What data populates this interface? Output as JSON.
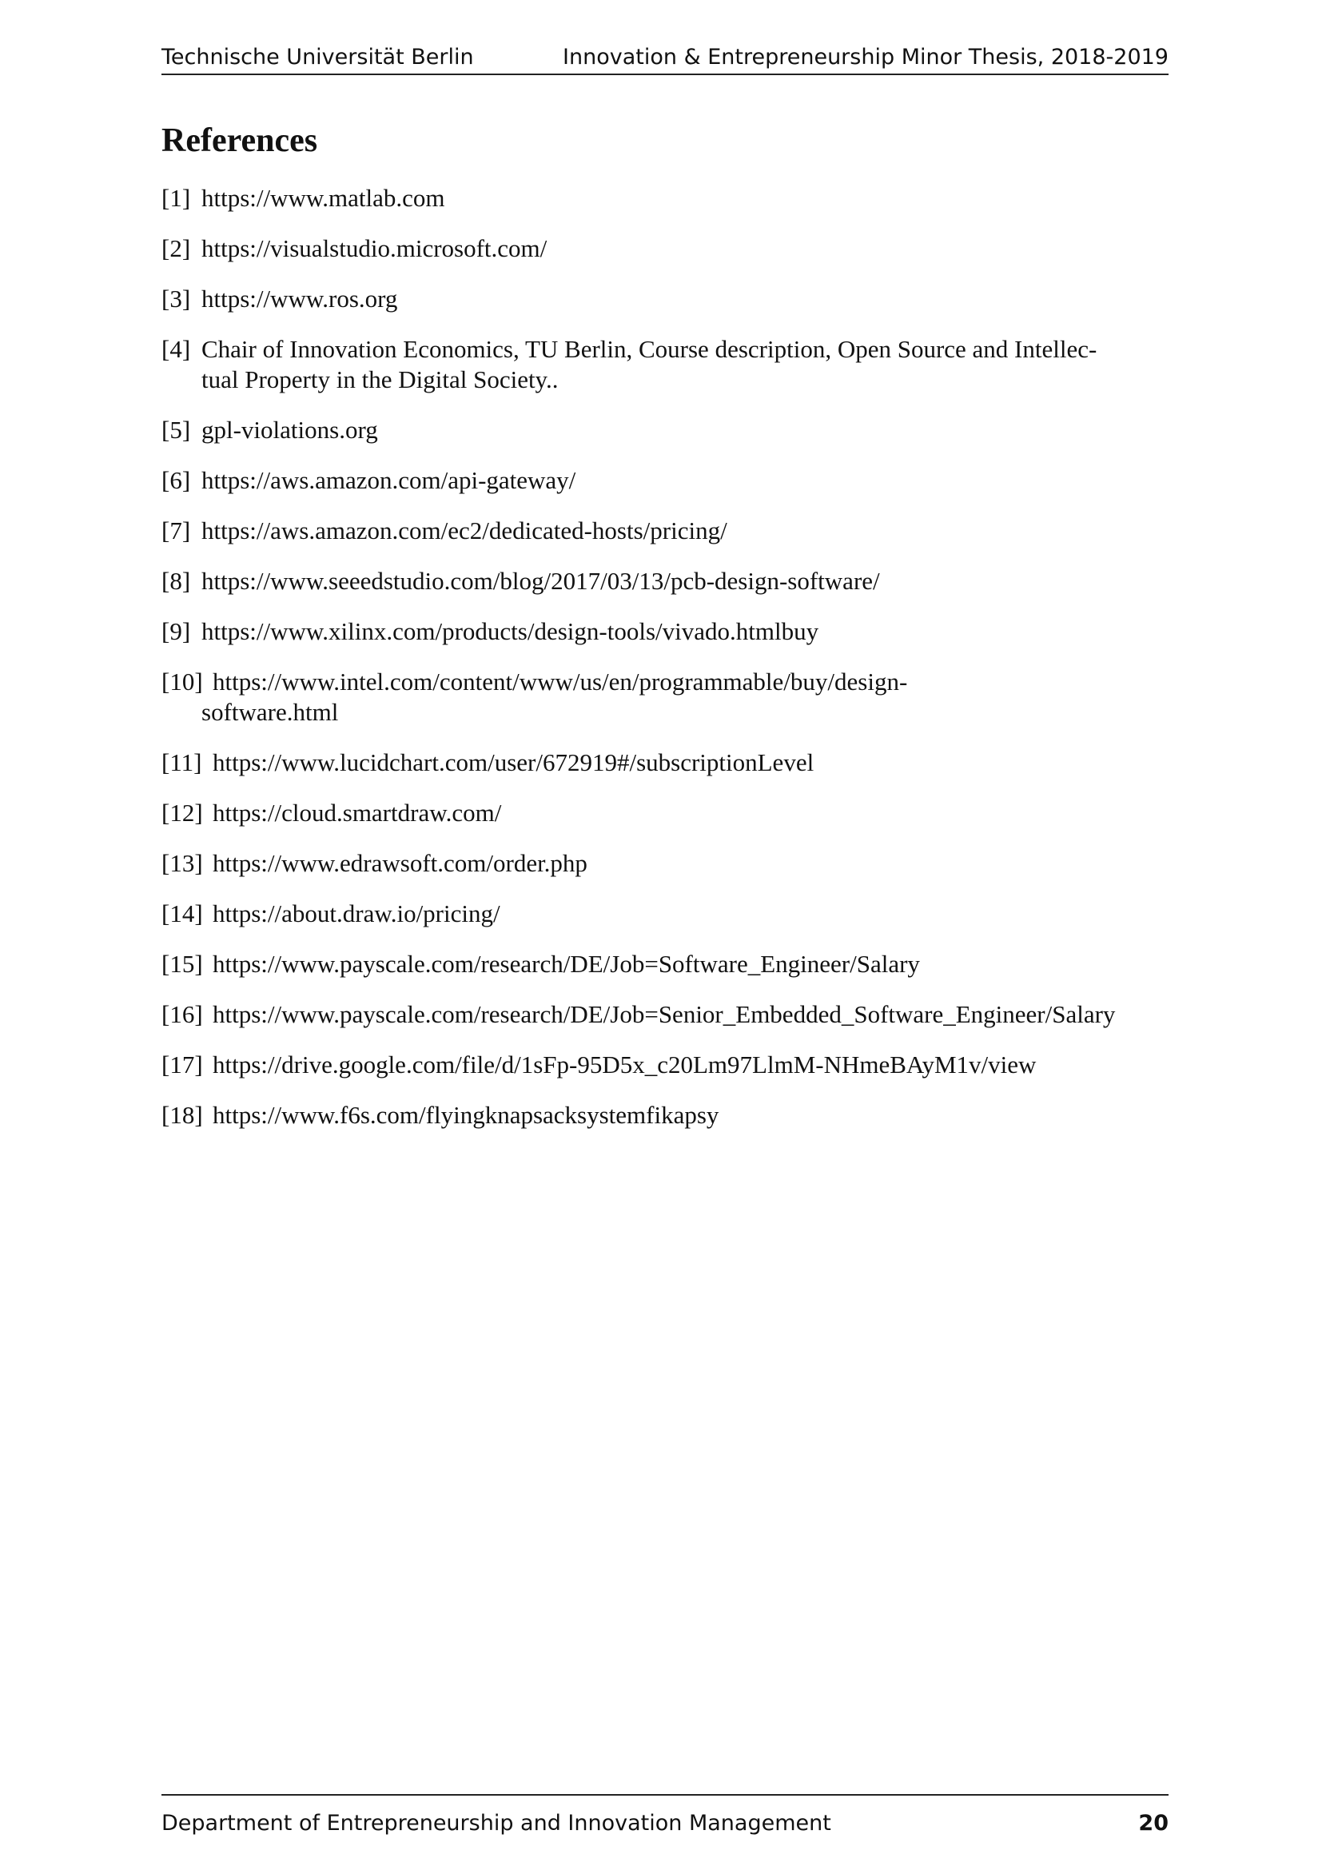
{
  "header": {
    "left": "Technische Universität Berlin",
    "right": "Innovation & Entrepreneurship Minor Thesis, 2018-2019"
  },
  "section_title": "References",
  "references": [
    {
      "num": "[1]",
      "text": "https://www.matlab.com"
    },
    {
      "num": "[2]",
      "text": "https://visualstudio.microsoft.com/"
    },
    {
      "num": "[3]",
      "text": "https://www.ros.org"
    },
    {
      "num": "[4]",
      "text": "Chair of Innovation Economics, TU Berlin, Course description, Open Source and Intellec-",
      "cont": "tual Property in the Digital Society.."
    },
    {
      "num": "[5]",
      "text": "gpl-violations.org"
    },
    {
      "num": "[6]",
      "text": "https://aws.amazon.com/api-gateway/"
    },
    {
      "num": "[7]",
      "text": "https://aws.amazon.com/ec2/dedicated-hosts/pricing/"
    },
    {
      "num": "[8]",
      "text": "https://www.seeedstudio.com/blog/2017/03/13/pcb-design-software/"
    },
    {
      "num": "[9]",
      "text": "https://www.xilinx.com/products/design-tools/vivado.htmlbuy"
    },
    {
      "num": "[10]",
      "text": "https://www.intel.com/content/www/us/en/programmable/buy/design-",
      "cont": "software.html"
    },
    {
      "num": "[11]",
      "text": "https://www.lucidchart.com/user/672919#/subscriptionLevel"
    },
    {
      "num": "[12]",
      "text": "https://cloud.smartdraw.com/"
    },
    {
      "num": "[13]",
      "text": "https://www.edrawsoft.com/order.php"
    },
    {
      "num": "[14]",
      "text": "https://about.draw.io/pricing/"
    },
    {
      "num": "[15]",
      "text": "https://www.payscale.com/research/DE/Job=Software_Engineer/Salary"
    },
    {
      "num": "[16]",
      "text": "https://www.payscale.com/research/DE/Job=Senior_Embedded_Software_Engineer/Salary"
    },
    {
      "num": "[17]",
      "text": "https://drive.google.com/file/d/1sFp-95D5x_c20Lm97LlmM-NHmeBAyM1v/view"
    },
    {
      "num": "[18]",
      "text": "https://www.f6s.com/flyingknapsacksystemfikapsy"
    }
  ],
  "footer": {
    "left": "Department of Entrepreneurship and Innovation Management",
    "page_number": "20"
  }
}
